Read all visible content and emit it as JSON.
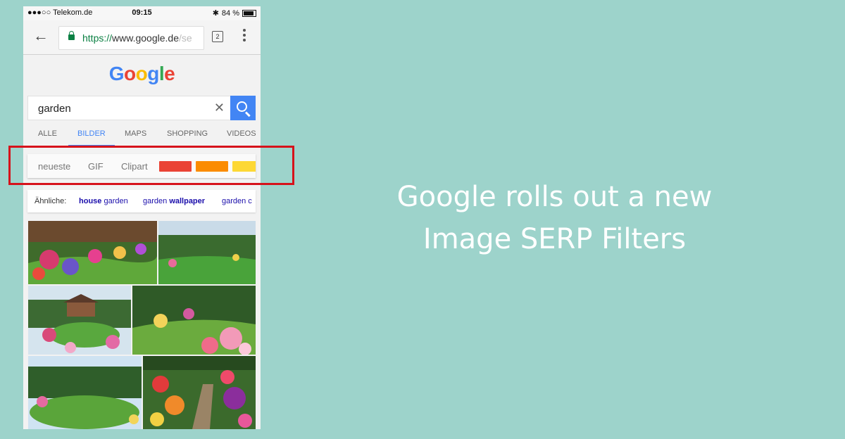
{
  "status": {
    "carrier": "●●●○○ Telekom.de",
    "time": "09:15",
    "battery": "84 %"
  },
  "browser": {
    "url_scheme": "https://",
    "url_host": "www.google.de",
    "url_rest": "/se",
    "tab_count": "2"
  },
  "logo": {
    "letters": [
      "G",
      "o",
      "o",
      "g",
      "l",
      "e"
    ],
    "colors": [
      "#4285f4",
      "#ea4335",
      "#fbbc05",
      "#4285f4",
      "#34a853",
      "#ea4335"
    ]
  },
  "search": {
    "query": "garden",
    "clear": "✕"
  },
  "tabs": [
    "ALLE",
    "BILDER",
    "MAPS",
    "SHOPPING",
    "VIDEOS"
  ],
  "filters": {
    "items": [
      "neueste",
      "GIF",
      "Clipart"
    ],
    "colors": [
      "#ea4335",
      "#fb8c00",
      "#fdd835"
    ]
  },
  "related": {
    "label": "Ähnliche:",
    "items": [
      {
        "bold": "house",
        "plain": " garden"
      },
      {
        "plain": "garden ",
        "bold": "wallpaper"
      },
      {
        "plain": "garden c",
        "bold": ""
      }
    ]
  },
  "caption": {
    "line1": "Google rolls out a new",
    "line2": "Image SERP Filters"
  }
}
